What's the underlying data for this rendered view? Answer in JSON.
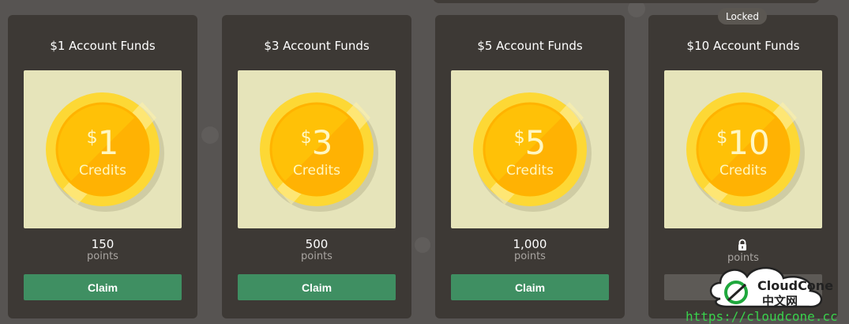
{
  "cards": [
    {
      "title": "$1 Account Funds",
      "coin": {
        "symbol": "$",
        "amount": "1",
        "label": "Credits"
      },
      "points_value": "150",
      "points_label": "points",
      "action": "Claim",
      "locked": false
    },
    {
      "title": "$3 Account Funds",
      "coin": {
        "symbol": "$",
        "amount": "3",
        "label": "Credits"
      },
      "points_value": "500",
      "points_label": "points",
      "action": "Claim",
      "locked": false
    },
    {
      "title": "$5 Account Funds",
      "coin": {
        "symbol": "$",
        "amount": "5",
        "label": "Credits"
      },
      "points_value": "1,000",
      "points_label": "points",
      "action": "Claim",
      "locked": false
    },
    {
      "title": "$10 Account Funds",
      "coin": {
        "symbol": "$",
        "amount": "10",
        "label": "Credits"
      },
      "points_value": "",
      "points_label": "points",
      "action": "",
      "locked": true,
      "status_badge": "Locked",
      "lock_icon": "lock-icon"
    }
  ],
  "watermark": {
    "brand": "CloudCone",
    "subtitle": "中文网",
    "url": "https://cloudcone.cc"
  },
  "colors": {
    "page_bg": "#575452",
    "card_bg": "#3d3935",
    "coin_panel_bg": "#e6e4ba",
    "claim_green": "#3f8f62",
    "coin_gold": "#ffc107",
    "coin_orange": "#ff9f00"
  }
}
